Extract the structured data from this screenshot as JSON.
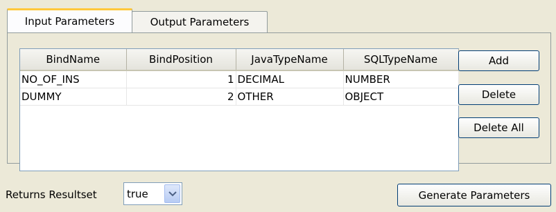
{
  "tabs": [
    {
      "label": "Input Parameters",
      "active": true
    },
    {
      "label": "Output Parameters",
      "active": false
    }
  ],
  "table": {
    "columns": [
      "BindName",
      "BindPosition",
      "JavaTypeName",
      "SQLTypeName"
    ],
    "rows": [
      [
        "NO_OF_INS",
        "1",
        "DECIMAL",
        "NUMBER"
      ],
      [
        "DUMMY",
        "2",
        "OTHER",
        "OBJECT"
      ]
    ]
  },
  "buttons": {
    "add": "Add",
    "delete": "Delete",
    "delete_all": "Delete All",
    "generate": "Generate Parameters"
  },
  "returns_resultset": {
    "label": "Returns Resultset",
    "value": "true"
  },
  "icons": {
    "dropdown": "chevron-down-icon"
  },
  "colors": {
    "background": "#ece9d8",
    "active_tab_accent": "#ffc83c",
    "button_border": "#003c74"
  }
}
